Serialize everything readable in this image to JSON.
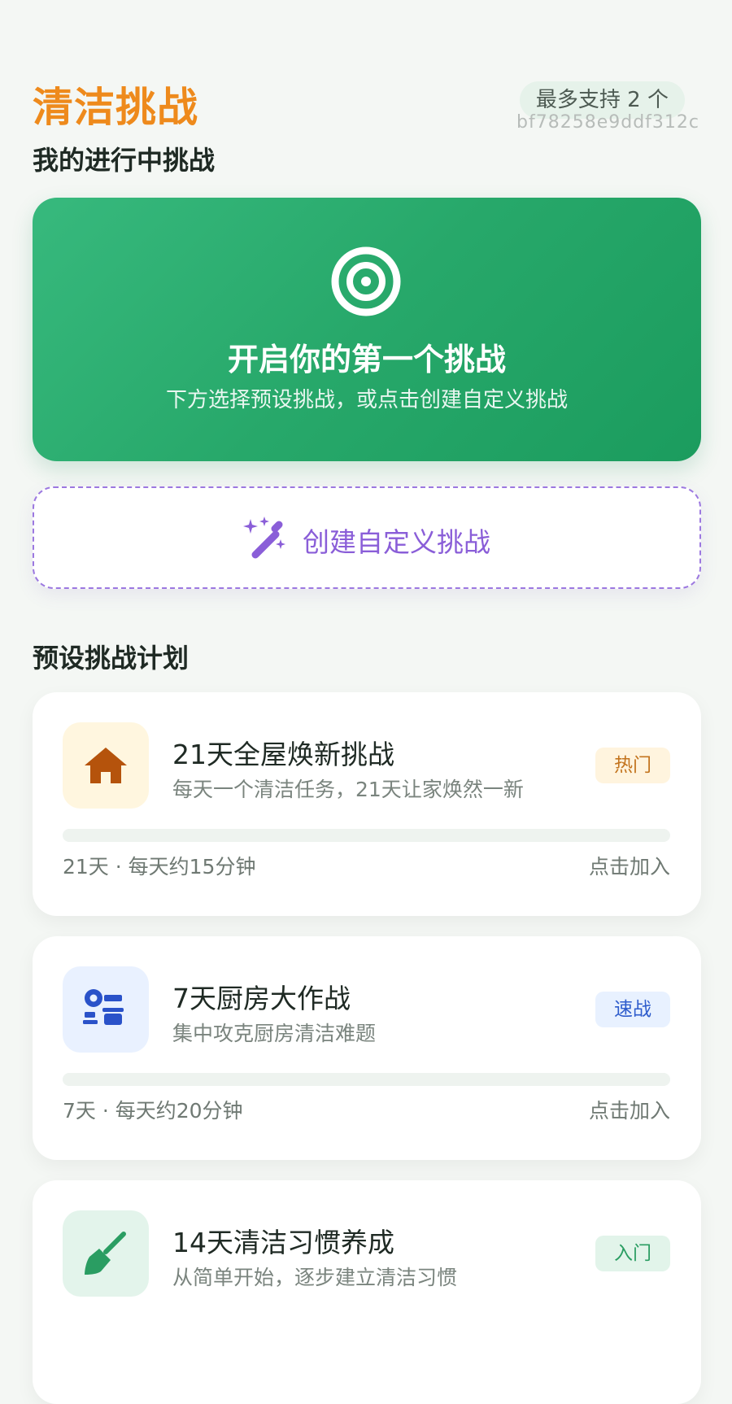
{
  "header": {
    "title": "清洁挑战",
    "limit_badge": "最多支持 2 个",
    "device_id": "bf78258e9ddf312c"
  },
  "active_section": {
    "heading": "我的进行中挑战",
    "empty_state": {
      "icon": "target-icon",
      "title": "开启你的第一个挑战",
      "subtitle": "下方选择预设挑战，或点击创建自定义挑战"
    }
  },
  "create_custom": {
    "icon": "magic-wand-icon",
    "label": "创建自定义挑战"
  },
  "preset_section": {
    "heading": "预设挑战计划",
    "plans": [
      {
        "icon": "house-icon",
        "icon_color": "#b5530c",
        "icon_bg": "#fff6df",
        "title": "21天全屋焕新挑战",
        "description": "每天一个清洁任务，21天让家焕然一新",
        "tag": "热门",
        "tag_color": "#c3741e",
        "tag_bg": "#fff4de",
        "progress": 0,
        "meta": "21天 · 每天约15分钟",
        "action": "点击加入"
      },
      {
        "icon": "kitchen-icon",
        "icon_color": "#2a52c9",
        "icon_bg": "#e9f1ff",
        "title": "7天厨房大作战",
        "description": "集中攻克厨房清洁难题",
        "tag": "速战",
        "tag_color": "#2e5ccc",
        "tag_bg": "#e8f1ff",
        "progress": 0,
        "meta": "7天 · 每天约20分钟",
        "action": "点击加入"
      },
      {
        "icon": "broom-icon",
        "icon_color": "#2a9d62",
        "icon_bg": "#e3f4eb",
        "title": "14天清洁习惯养成",
        "description": "从简单开始，逐步建立清洁习惯",
        "tag": "入门",
        "tag_color": "#2a9d62",
        "tag_bg": "#e2f4ea",
        "progress": 0,
        "meta": "",
        "action": ""
      }
    ]
  }
}
